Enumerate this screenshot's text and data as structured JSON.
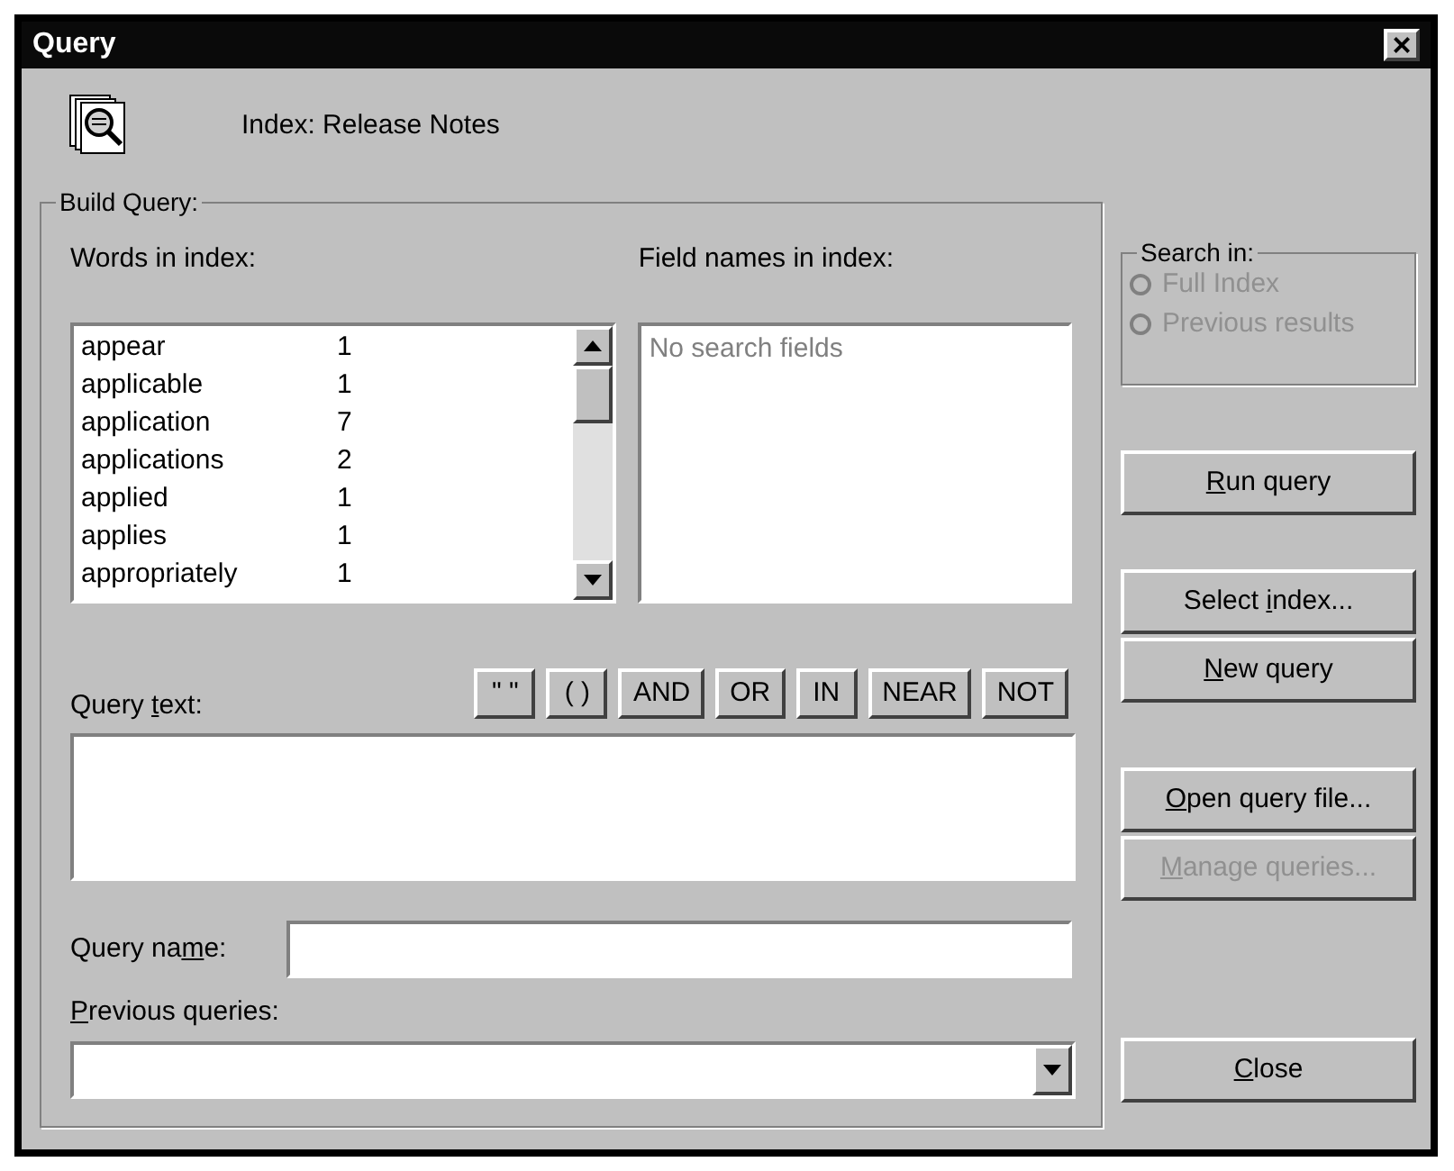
{
  "window": {
    "title": "Query",
    "close_glyph": "×"
  },
  "index_label": "Index: Release Notes",
  "build_query": {
    "title": "Build Query:",
    "words_label": "Words in index:",
    "words": [
      {
        "word": "appear",
        "count": "1"
      },
      {
        "word": "applicable",
        "count": "1"
      },
      {
        "word": "application",
        "count": "7"
      },
      {
        "word": "applications",
        "count": "2"
      },
      {
        "word": "applied",
        "count": "1"
      },
      {
        "word": "applies",
        "count": "1"
      },
      {
        "word": "appropriately",
        "count": "1"
      }
    ],
    "fields_label": "Field names in index:",
    "fields_placeholder": "No search fields",
    "operators": [
      "\" \"",
      "( )",
      "AND",
      "OR",
      "IN",
      "NEAR",
      "NOT"
    ],
    "query_text_label": "Query text:",
    "query_name_label": "Query name:",
    "previous_label": "Previous queries:"
  },
  "search_in": {
    "title": "Search in:",
    "options": [
      {
        "label": "Full Index",
        "selected": false,
        "disabled": true
      },
      {
        "label": "Previous results",
        "selected": false,
        "disabled": true
      }
    ]
  },
  "buttons": [
    {
      "label": "Run query",
      "disabled": false
    },
    {
      "label": "Select index...",
      "disabled": false
    },
    {
      "label": "New query",
      "disabled": false
    },
    {
      "label": "Open query file...",
      "disabled": false
    },
    {
      "label": "Manage queries...",
      "disabled": true
    },
    {
      "label": "Close",
      "disabled": false
    }
  ]
}
